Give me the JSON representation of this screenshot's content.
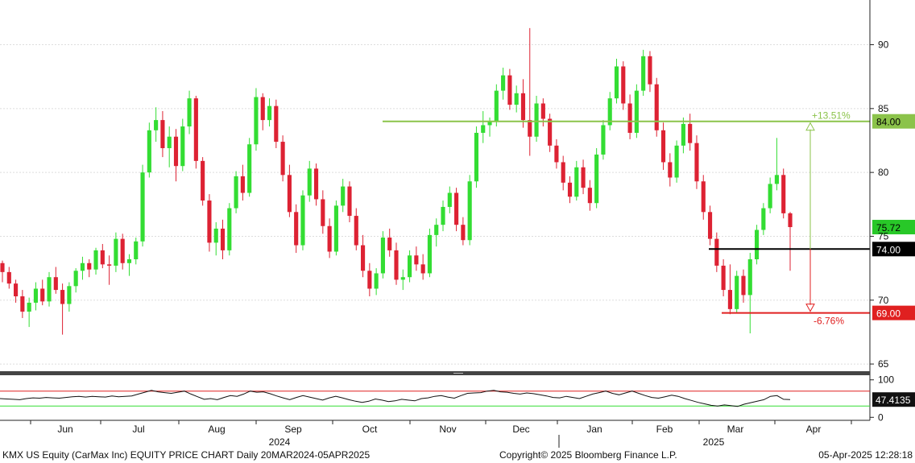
{
  "chart_data": [
    {
      "type": "candlestick",
      "panel": "price",
      "y_ticks": [
        "65",
        "70",
        "75",
        "80",
        "85",
        "90"
      ],
      "ylim": [
        64.5,
        93.5
      ],
      "grid": true,
      "candles_ohlc": [
        [
          72.9,
          73.1,
          71.4,
          72.2
        ],
        [
          72.2,
          72.6,
          70.9,
          71.3
        ],
        [
          71.3,
          71.6,
          69.8,
          70.3
        ],
        [
          70.3,
          70.8,
          68.6,
          69.1
        ],
        [
          69.1,
          70.2,
          67.9,
          69.8
        ],
        [
          69.8,
          71.4,
          69.2,
          70.9
        ],
        [
          70.9,
          71.6,
          69.6,
          69.9
        ],
        [
          69.9,
          72.2,
          69.5,
          71.8
        ],
        [
          71.8,
          72.6,
          70.5,
          70.8
        ],
        [
          70.8,
          71.3,
          67.3,
          69.7
        ],
        [
          69.7,
          71.4,
          69.1,
          71.1
        ],
        [
          71.1,
          72.5,
          70.6,
          72.3
        ],
        [
          72.3,
          73.4,
          71.6,
          72.9
        ],
        [
          72.9,
          73.2,
          71.8,
          72.4
        ],
        [
          72.4,
          74.1,
          72.0,
          73.9
        ],
        [
          73.9,
          74.4,
          72.5,
          72.8
        ],
        [
          72.8,
          73.5,
          71.2,
          72.7
        ],
        [
          72.7,
          75.3,
          72.2,
          74.8
        ],
        [
          74.8,
          75.2,
          72.4,
          72.9
        ],
        [
          72.9,
          73.6,
          71.9,
          73.2
        ],
        [
          73.2,
          74.9,
          72.8,
          74.6
        ],
        [
          74.6,
          80.6,
          74.2,
          80.0
        ],
        [
          80.0,
          83.9,
          79.6,
          83.3
        ],
        [
          83.3,
          85.1,
          82.4,
          84.1
        ],
        [
          84.1,
          84.8,
          81.2,
          81.9
        ],
        [
          81.9,
          83.6,
          80.4,
          82.8
        ],
        [
          82.8,
          83.4,
          79.3,
          80.5
        ],
        [
          80.5,
          84.2,
          80.1,
          83.6
        ],
        [
          83.6,
          86.4,
          83.0,
          85.8
        ],
        [
          85.8,
          86.0,
          80.3,
          80.9
        ],
        [
          80.9,
          81.2,
          77.4,
          77.8
        ],
        [
          77.8,
          78.3,
          73.8,
          74.5
        ],
        [
          74.5,
          76.1,
          73.5,
          75.6
        ],
        [
          75.6,
          76.3,
          73.2,
          73.9
        ],
        [
          73.9,
          77.6,
          73.5,
          77.2
        ],
        [
          77.2,
          80.1,
          76.8,
          79.7
        ],
        [
          79.7,
          80.6,
          77.8,
          78.4
        ],
        [
          78.4,
          82.7,
          78.1,
          82.2
        ],
        [
          82.2,
          86.6,
          81.7,
          85.9
        ],
        [
          85.9,
          86.2,
          83.3,
          84.1
        ],
        [
          84.1,
          85.8,
          83.6,
          85.2
        ],
        [
          85.2,
          85.7,
          81.9,
          82.4
        ],
        [
          82.4,
          82.9,
          79.3,
          79.8
        ],
        [
          79.8,
          80.6,
          76.5,
          76.9
        ],
        [
          76.9,
          77.5,
          73.7,
          74.3
        ],
        [
          74.3,
          78.6,
          73.9,
          78.2
        ],
        [
          78.2,
          80.9,
          77.7,
          80.3
        ],
        [
          80.3,
          80.7,
          77.4,
          77.9
        ],
        [
          77.9,
          78.6,
          75.2,
          75.8
        ],
        [
          75.8,
          76.4,
          73.3,
          73.8
        ],
        [
          73.8,
          77.8,
          73.5,
          77.4
        ],
        [
          77.4,
          79.5,
          76.9,
          78.9
        ],
        [
          78.9,
          79.3,
          76.1,
          76.6
        ],
        [
          76.6,
          77.2,
          73.9,
          74.3
        ],
        [
          74.3,
          75.1,
          71.8,
          72.3
        ],
        [
          72.3,
          72.9,
          70.3,
          70.9
        ],
        [
          70.9,
          72.5,
          70.4,
          72.1
        ],
        [
          72.1,
          75.4,
          71.7,
          74.9
        ],
        [
          74.9,
          75.6,
          73.4,
          73.9
        ],
        [
          73.9,
          74.5,
          71.2,
          71.6
        ],
        [
          71.6,
          72.4,
          70.8,
          71.8
        ],
        [
          71.8,
          73.9,
          71.4,
          73.5
        ],
        [
          73.5,
          74.2,
          72.3,
          72.8
        ],
        [
          72.8,
          73.6,
          71.6,
          72.1
        ],
        [
          72.1,
          75.6,
          71.8,
          75.1
        ],
        [
          75.1,
          76.4,
          74.2,
          75.9
        ],
        [
          75.9,
          77.8,
          75.4,
          77.3
        ],
        [
          77.3,
          78.9,
          76.8,
          78.4
        ],
        [
          78.4,
          78.8,
          75.4,
          75.9
        ],
        [
          75.9,
          76.5,
          74.3,
          74.7
        ],
        [
          74.7,
          79.8,
          74.3,
          79.3
        ],
        [
          79.3,
          83.6,
          78.8,
          83.1
        ],
        [
          83.1,
          84.8,
          82.3,
          83.7
        ],
        [
          83.7,
          84.3,
          82.8,
          84.0
        ],
        [
          84.0,
          86.9,
          83.6,
          86.4
        ],
        [
          86.4,
          88.2,
          85.7,
          87.6
        ],
        [
          87.6,
          88.1,
          84.9,
          85.3
        ],
        [
          85.3,
          86.8,
          84.7,
          86.2
        ],
        [
          86.2,
          87.3,
          83.5,
          84.1
        ],
        [
          84.1,
          91.3,
          81.3,
          82.8
        ],
        [
          82.8,
          86.0,
          82.4,
          85.4
        ],
        [
          85.4,
          85.8,
          83.6,
          84.2
        ],
        [
          84.2,
          84.6,
          81.6,
          82.1
        ],
        [
          82.1,
          82.6,
          80.3,
          80.8
        ],
        [
          80.8,
          81.3,
          78.6,
          79.2
        ],
        [
          79.2,
          79.7,
          77.6,
          78.1
        ],
        [
          78.1,
          80.9,
          77.8,
          80.4
        ],
        [
          80.4,
          81.0,
          78.3,
          78.8
        ],
        [
          78.8,
          79.4,
          77.0,
          77.6
        ],
        [
          77.6,
          81.9,
          77.2,
          81.4
        ],
        [
          81.4,
          84.1,
          81.0,
          83.7
        ],
        [
          83.7,
          86.3,
          83.3,
          85.8
        ],
        [
          85.8,
          88.9,
          85.4,
          88.3
        ],
        [
          88.3,
          88.7,
          84.9,
          85.4
        ],
        [
          85.4,
          86.1,
          82.6,
          83.1
        ],
        [
          83.1,
          86.9,
          82.7,
          86.4
        ],
        [
          86.4,
          89.6,
          86.0,
          89.1
        ],
        [
          89.1,
          89.5,
          86.3,
          86.9
        ],
        [
          86.9,
          87.4,
          82.8,
          83.3
        ],
        [
          83.3,
          83.9,
          80.2,
          80.8
        ],
        [
          80.8,
          81.5,
          78.9,
          79.6
        ],
        [
          79.6,
          82.5,
          79.2,
          82.1
        ],
        [
          82.1,
          84.3,
          81.5,
          83.8
        ],
        [
          83.8,
          84.6,
          81.7,
          82.3
        ],
        [
          82.3,
          82.9,
          78.7,
          79.3
        ],
        [
          79.3,
          79.8,
          76.3,
          76.9
        ],
        [
          76.9,
          77.4,
          74.3,
          74.8
        ],
        [
          74.8,
          75.3,
          72.2,
          72.7
        ],
        [
          72.7,
          73.2,
          70.3,
          70.8
        ],
        [
          70.8,
          72.8,
          68.9,
          69.3
        ],
        [
          69.3,
          72.3,
          69.0,
          71.9
        ],
        [
          71.9,
          72.4,
          69.8,
          70.4
        ],
        [
          70.4,
          73.7,
          67.4,
          73.2
        ],
        [
          73.2,
          75.9,
          72.8,
          75.5
        ],
        [
          75.5,
          77.6,
          75.1,
          77.2
        ],
        [
          77.2,
          79.6,
          76.8,
          79.1
        ],
        [
          79.1,
          82.7,
          78.6,
          79.8
        ],
        [
          79.8,
          80.3,
          76.4,
          76.8
        ],
        [
          76.8,
          76.9,
          72.3,
          75.72
        ]
      ],
      "reference_lines": [
        {
          "label": "84.00",
          "value": 84.0,
          "color": "#8bc34a"
        },
        {
          "label": "74.00",
          "value": 74.0,
          "color": "#000000"
        },
        {
          "label": "69.00",
          "value": 69.0,
          "color": "#e02020"
        }
      ],
      "last_price": {
        "label": "75.72",
        "value": 75.72,
        "color": "#28c828"
      },
      "annotations": [
        {
          "text": "+13.51%",
          "color": "#8bc34a"
        },
        {
          "text": "-6.76%",
          "color": "#e02020"
        }
      ]
    },
    {
      "type": "line",
      "panel": "indicator",
      "y_ticks": [
        "100",
        "0"
      ],
      "ylim": [
        -8,
        108
      ],
      "upper_band": 70,
      "lower_band": 30,
      "last_value_label": "47.4135",
      "values": [
        50,
        49,
        48,
        47,
        50,
        52,
        51,
        53,
        52,
        51,
        53,
        55,
        56,
        54,
        56,
        55,
        54,
        57,
        55,
        56,
        57,
        62,
        67,
        72,
        68,
        66,
        64,
        67,
        70,
        62,
        55,
        48,
        50,
        47,
        53,
        58,
        56,
        62,
        70,
        67,
        68,
        63,
        57,
        52,
        47,
        53,
        58,
        54,
        50,
        46,
        52,
        56,
        52,
        47,
        43,
        40,
        43,
        49,
        46,
        42,
        44,
        48,
        46,
        44,
        50,
        52,
        56,
        58,
        54,
        51,
        58,
        64,
        65,
        66,
        70,
        72,
        68,
        67,
        64,
        62,
        65,
        63,
        60,
        57,
        53,
        52,
        56,
        53,
        50,
        56,
        62,
        66,
        70,
        64,
        60,
        65,
        70,
        64,
        58,
        53,
        51,
        55,
        59,
        56,
        50,
        45,
        40,
        36,
        32,
        30,
        33,
        31,
        29,
        35,
        39,
        43,
        47,
        56,
        58,
        48,
        47.4135
      ]
    }
  ],
  "x_axis": {
    "months": [
      "Jun",
      "Jul",
      "Aug",
      "Sep",
      "Oct",
      "Nov",
      "Dec",
      "Jan",
      "Feb",
      "Mar",
      "Apr"
    ],
    "years": [
      "2024",
      "2025"
    ]
  },
  "footer": {
    "left": "KMX US Equity (CarMax Inc) EQUITY PRICE CHART  Daily 20MAR2024-05APR2025",
    "center": "Copyright© 2025 Bloomberg Finance L.P.",
    "right": "05-Apr-2025 12:28:18"
  },
  "colors": {
    "up": "#33dd33",
    "down": "#dd2233",
    "grid": "#dddddd"
  }
}
